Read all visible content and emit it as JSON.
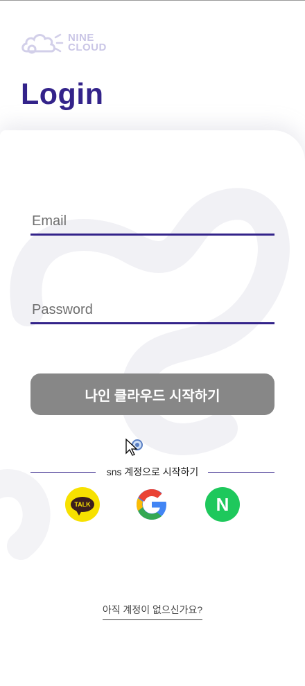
{
  "brand": {
    "line1": "NINE",
    "line2": "CLOUD"
  },
  "page": {
    "title": "Login"
  },
  "form": {
    "email_placeholder": "Email",
    "email_value": "",
    "password_placeholder": "Password",
    "password_value": "",
    "submit_label": "나인 클라우드 시작하기"
  },
  "sns": {
    "divider_label": "sns 계정으로 시작하기",
    "kakao_text": "TALK",
    "naver_text": "N",
    "providers": [
      "kakao-icon",
      "google-icon",
      "naver-icon"
    ]
  },
  "footer": {
    "signup_link": "아직 계정이 없으신가요?"
  },
  "colors": {
    "accent": "#33238a",
    "button": "#878787",
    "kakao": "#f7e100",
    "naver": "#1ec85c"
  }
}
